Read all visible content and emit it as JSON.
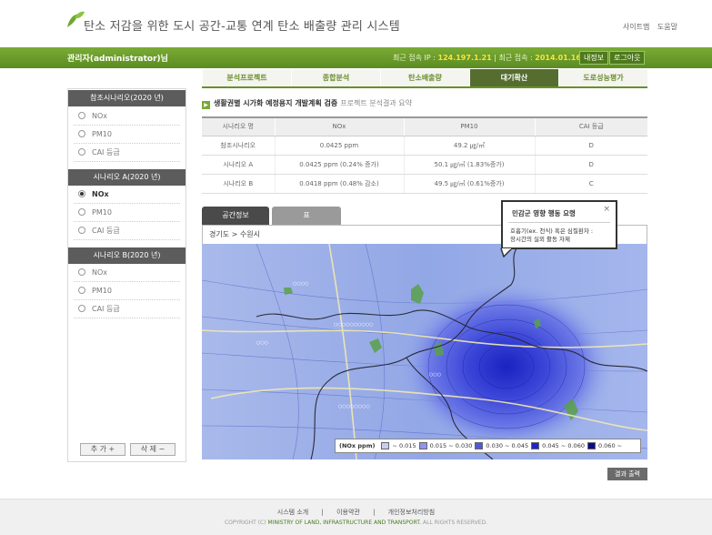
{
  "header": {
    "title": "탄소 저감을 위한 도시 공간-교통 연계 탄소 배출량 관리 시스템",
    "links": [
      "사이트맵",
      "도움말"
    ]
  },
  "userbar": {
    "user": "관리자(administrator)님",
    "ip_label": "최근 접속 IP :",
    "ip": "124.197.1.21",
    "date_label": "| 최근 접속 :",
    "date": "2014.01.16",
    "my_info": "내정보",
    "logout": "로그아웃"
  },
  "tabs": [
    {
      "label": "분석프로젝트",
      "active": false
    },
    {
      "label": "종합분석",
      "active": false
    },
    {
      "label": "탄소배출량",
      "active": false
    },
    {
      "label": "대기확산",
      "active": true
    },
    {
      "label": "도로성능평가",
      "active": false
    }
  ],
  "sidebar": {
    "groups": [
      {
        "title": "참조시나리오(2020 년)",
        "items": [
          {
            "label": "NOx",
            "selected": false
          },
          {
            "label": "PM10",
            "selected": false
          },
          {
            "label": "CAI 등급",
            "selected": false
          }
        ]
      },
      {
        "title": "시나리오 A(2020 년)",
        "items": [
          {
            "label": "NOx",
            "selected": true
          },
          {
            "label": "PM10",
            "selected": false
          },
          {
            "label": "CAI 등급",
            "selected": false
          }
        ]
      },
      {
        "title": "시나리오 B(2020 년)",
        "items": [
          {
            "label": "NOx",
            "selected": false
          },
          {
            "label": "PM10",
            "selected": false
          },
          {
            "label": "CAI 등급",
            "selected": false
          }
        ]
      }
    ],
    "add_button": "추 가 +",
    "delete_button": "삭 제 −"
  },
  "section": {
    "title": "생활권별 시가화 예정용지 개발계획 검증",
    "subtitle": "프로젝트 분석결과 요약"
  },
  "table": {
    "headers": [
      "시나리오 명",
      "NOx",
      "PM10",
      "CAI 등급"
    ],
    "rows": [
      [
        "참조시나리오",
        "0.0425 ppm",
        "49.2 ㎍/㎥",
        "D"
      ],
      [
        "시나리오 A",
        "0.0425 ppm (0.24% 증가)",
        "50.1 ㎍/㎥ (1.83%증가)",
        "D"
      ],
      [
        "시나리오 B",
        "0.0418 ppm (0.48% 감소)",
        "49.5 ㎍/㎥ (0.61%증가)",
        "C"
      ]
    ]
  },
  "map_tabs": [
    "공간정보",
    "표"
  ],
  "breadcrumb": "경기도 > 수원시",
  "legend": {
    "title": "(NOx ppm)",
    "items": [
      {
        "label": "~ 0.015",
        "color": "#c8cef4"
      },
      {
        "label": "0.015 ~ 0.030",
        "color": "#8f96ee"
      },
      {
        "label": "0.030 ~ 0.045",
        "color": "#5057e0"
      },
      {
        "label": "0.045 ~ 0.060",
        "color": "#2025c8"
      },
      {
        "label": "0.060 ~",
        "color": "#0a0c8a"
      }
    ]
  },
  "popup": {
    "title": "민감군 영향 행동 요령",
    "body_line1": "호흡기(ex. 천식) 혹은 심질환자 :",
    "body_line2": "장시간의 실외 활동 자제"
  },
  "print_button": "결과 출력",
  "footer": {
    "links": [
      "시스템 소개",
      "|",
      "이용약관",
      "|",
      "개인정보처리방침"
    ],
    "copyright_prefix": "COPYRIGHT (C)",
    "copyright_org": "MINISTRY OF LAND, INFRASTRUCTURE AND TRANSPORT.",
    "copyright_suffix": "ALL RIGHTS RESERVED."
  }
}
